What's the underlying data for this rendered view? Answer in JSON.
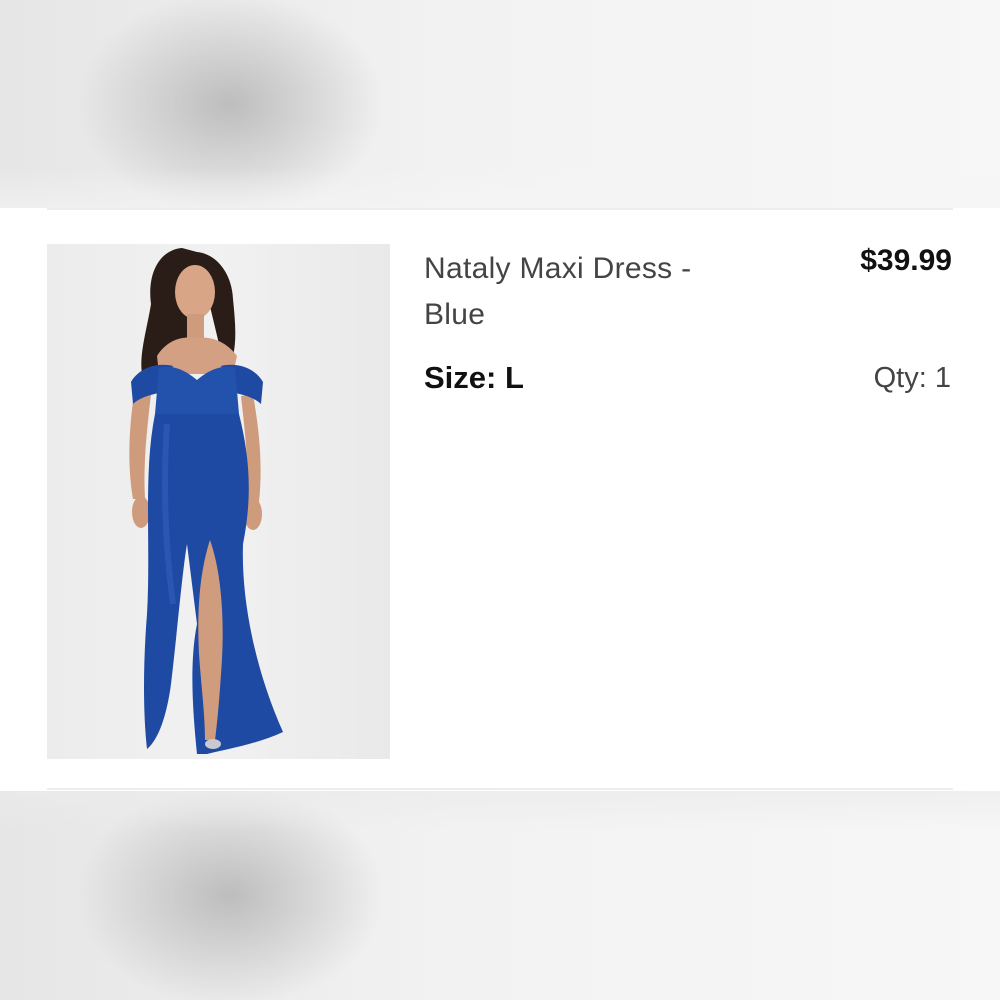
{
  "cart_item": {
    "title": "Nataly Maxi Dress - Blue",
    "price": "$39.99",
    "size_label": "Size:",
    "size_value": "L",
    "qty_label": "Qty:",
    "qty_value": "1",
    "image_subject": "woman in blue off-shoulder maxi dress",
    "dress_color": "#1f4aa3"
  }
}
